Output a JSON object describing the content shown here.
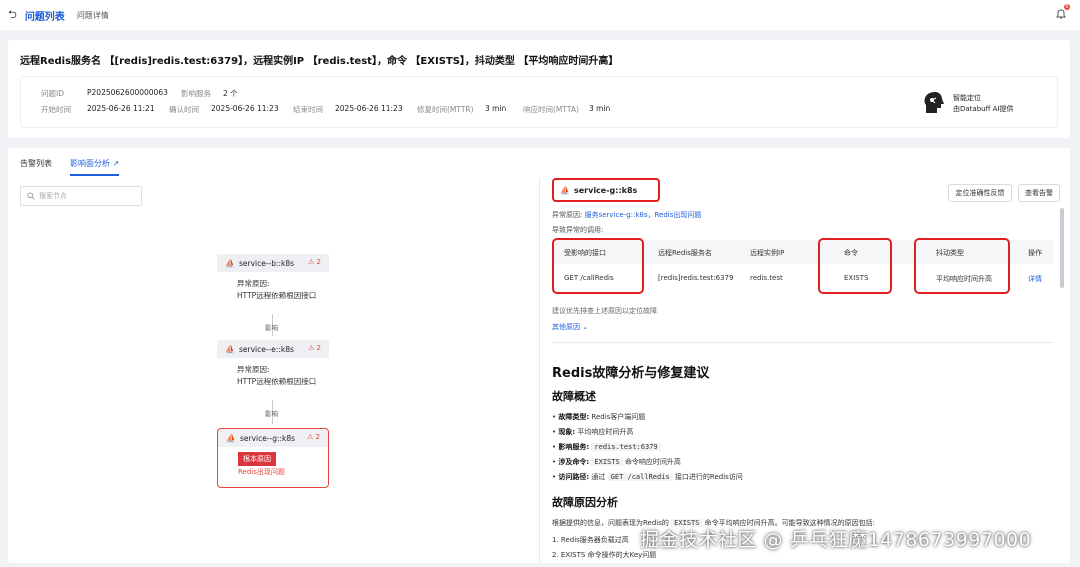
{
  "topbar": {
    "back_icon": "back-icon",
    "tabs": [
      "问题列表",
      "问题详情"
    ],
    "notification_count": "6"
  },
  "summary": {
    "title": "远程Redis服务名 【[redis]redis.test:6379】，远程实例IP 【redis.test】，命令 【EXISTS】，抖动类型 【平均响应时间升高】",
    "fields": {
      "problem_id_label": "问题ID",
      "problem_id": "P2025062600000063",
      "affected_label": "影响服务",
      "affected": "2 个",
      "start_label": "开始时间",
      "start": "2025-06-26 11:21",
      "confirm_label": "确认时间",
      "confirm": "2025-06-26 11:23",
      "end_label": "结束时间",
      "end": "2025-06-26 11:23",
      "mttr_label": "修复时间(MTTR)",
      "mttr": "3 min",
      "mtta_label": "响应时间(MTTA)",
      "mtta": "3 min"
    },
    "ai": {
      "line1": "智能定位",
      "line2": "由Databuff AI提供"
    }
  },
  "tabs": {
    "alerts": "告警列表",
    "impact": "影响面分析"
  },
  "search": {
    "placeholder": "搜索节点"
  },
  "graph": {
    "nodes": [
      {
        "name": "service--b::k8s",
        "alerts": "2",
        "cause_label": "异常原因:",
        "cause": "HTTP远程依赖根因接口"
      },
      {
        "name": "service--e::k8s",
        "alerts": "2",
        "cause_label": "异常原因:",
        "cause": "HTTP远程依赖根因接口"
      },
      {
        "name": "service--g::k8s",
        "alerts": "2",
        "root_tag": "根本原因",
        "cause": "Redis出现问题"
      }
    ],
    "edge_label": "影响"
  },
  "detail": {
    "service": "service-g::k8s",
    "buttons": {
      "feedback": "定位准确性反馈",
      "alerts": "查看告警"
    },
    "cause_prefix": "异常原因:",
    "cause_link": "服务service-g::k8s，Redis出现问题",
    "cause2": "导致异常的调用:",
    "table": {
      "headers": [
        "受影响的接口",
        "远程Redis服务名",
        "远程实例IP",
        "命令",
        "抖动类型",
        "操作"
      ],
      "row": [
        "GET /callRedis",
        "[redis]redis.test:6379",
        "redis.test",
        "EXISTS",
        "平均响应时间升高",
        "详情"
      ]
    },
    "suggest": "建议优先排查上述原因以定位故障",
    "more": "其他原因 ⌄"
  },
  "report": {
    "title": "Redis故障分析与修复建议",
    "overview_title": "故障概述",
    "bullets": [
      {
        "label": "故障类型:",
        "text": "Redis客户端问题"
      },
      {
        "label": "现象:",
        "text": "平均响应时间升高"
      },
      {
        "label": "影响服务:",
        "code": "redis.test:6379"
      },
      {
        "label": "涉及命令:",
        "code": "EXISTS",
        "text": "命令响应时间升高"
      },
      {
        "label": "访问路径:",
        "pre": "通过",
        "code": "GET /callRedis",
        "text": "接口进行的Redis访问"
      }
    ],
    "analysis_title": "故障原因分析",
    "analysis_intro_pre": "根据提供的信息，问题表现为Redis的",
    "analysis_code": "EXISTS",
    "analysis_intro_post": "命令平均响应时间升高。可能导致这种情况的原因包括:",
    "item1": "1. Redis服务器负载过高",
    "item2": "2. EXISTS 命令操作的大Key问题"
  },
  "watermark": "掘金技术社区 @ 乒乓狂魔1478673997000"
}
